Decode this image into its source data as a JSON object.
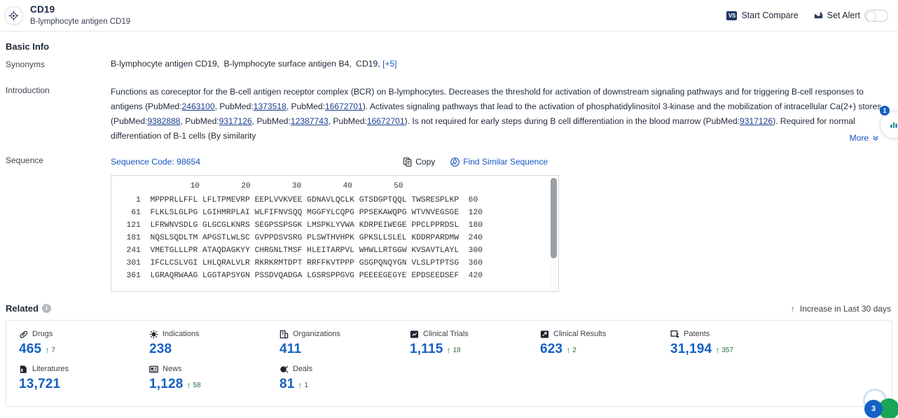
{
  "header": {
    "logo_icon": "target-crosshair-icon",
    "name": "CD19",
    "subtitle": "B-lymphocyte antigen CD19",
    "compare_label": "Start Compare",
    "compare_icon": "vs-icon",
    "alert_label": "Set Alert",
    "alert_icon": "bell-envelope-icon",
    "alert_toggle_on": false
  },
  "basic_info": {
    "title": "Basic Info",
    "synonyms_label": "Synonyms",
    "synonyms": [
      "B-lymphocyte antigen CD19",
      "B-lymphocyte surface antigen B4",
      "CD19"
    ],
    "synonyms_more": "[+5]",
    "introduction_label": "Introduction",
    "introduction": {
      "p1": "Functions as coreceptor for the B-cell antigen receptor complex (BCR) on B-lymphocytes. Decreases the threshold for activation of downstream signaling pathways and for triggering B-cell responses to antigens (PubMed:",
      "refs1": [
        "2463100",
        "1373518",
        "16672701"
      ],
      "p2": "). Activates signaling pathways that lead to the activation of phosphatidylinositol 3-kinase and the mobilization of intracellular Ca(2+) stores (PubMed:",
      "refs2": [
        "9382888",
        "9317126",
        "12387743",
        "16672701"
      ],
      "p3": "). Is not required for early steps during B cell differentiation in the blood marrow (PubMed:",
      "refs3": [
        "9317126"
      ],
      "p4": "). Required for normal differentiation of B-1 cells (By similarity",
      "more_label": "More",
      "more_icon": "chevron-double-down-icon"
    }
  },
  "sequence": {
    "label": "Sequence",
    "code_label": "Sequence Code: 98654",
    "copy_label": "Copy",
    "copy_icon": "copy-icon",
    "find_label": "Find Similar Sequence",
    "find_icon": "search-similar-icon",
    "ruler_ticks": [
      "10",
      "20",
      "30",
      "40",
      "50"
    ],
    "rows": [
      {
        "start": "1",
        "blocks": [
          "MPPPRLLFFL",
          "LFLTPMEVRP",
          "EEPLVVKVEE",
          "GDNAVLQCLK",
          "GTSDGPTQQL",
          "TWSRESPLKP"
        ],
        "end": "60"
      },
      {
        "start": "61",
        "blocks": [
          "FLKLSLGLPG",
          "LGIHMRPLAI",
          "WLFIFNVSQQ",
          "MGGFYLCQPG",
          "PPSEKAWQPG",
          "WTVNVEGSGE"
        ],
        "end": "120"
      },
      {
        "start": "121",
        "blocks": [
          "LFRWNVSDLG",
          "GLGCGLKNRS",
          "SEGPSSPSGK",
          "LMSPKLYVWA",
          "KDRPEIWEGE",
          "PPCLPPRDSL"
        ],
        "end": "180"
      },
      {
        "start": "181",
        "blocks": [
          "NQSLSQDLTM",
          "APGSTLWLSC",
          "GVPPDSVSRG",
          "PLSWTHVHPK",
          "GPKSLLSLEL",
          "KDDRPARDMW"
        ],
        "end": "240"
      },
      {
        "start": "241",
        "blocks": [
          "VMETGLLLPR",
          "ATAQDAGKYY",
          "CHRGNLTMSF",
          "HLEITARPVL",
          "WHWLLRTGGW",
          "KVSAVTLAYL"
        ],
        "end": "300"
      },
      {
        "start": "301",
        "blocks": [
          "IFCLCSLVGI",
          "LHLQRALVLR",
          "RKRKRMTDPT",
          "RRFFKVTPPP",
          "GSGPQNQYGN",
          "VLSLPTPTSG"
        ],
        "end": "360"
      },
      {
        "start": "361",
        "blocks": [
          "LGRAQRWAAG",
          "LGGTAPSYGN",
          "PSSDVQADGA",
          "LGSRSPPGVG",
          "PEEEEGEGYE",
          "EPDSEEDSEF"
        ],
        "end": "420"
      }
    ]
  },
  "related": {
    "title": "Related",
    "info_icon": "info-icon",
    "legend_icon": "arrow-up-icon",
    "legend_label": "Increase in Last 30 days",
    "stats": [
      {
        "icon": "pill-icon",
        "label": "Drugs",
        "value": "465",
        "delta": "7"
      },
      {
        "icon": "virus-icon",
        "label": "Indications",
        "value": "238",
        "delta": ""
      },
      {
        "icon": "building-icon",
        "label": "Organizations",
        "value": "411",
        "delta": ""
      },
      {
        "icon": "clinical-trial-icon",
        "label": "Clinical Trials",
        "value": "1,115",
        "delta": "18"
      },
      {
        "icon": "clinical-result-icon",
        "label": "Clinical Results",
        "value": "623",
        "delta": "2"
      },
      {
        "icon": "patent-icon",
        "label": "Patents",
        "value": "31,194",
        "delta": "357"
      },
      {
        "icon": "literature-icon",
        "label": "Literatures",
        "value": "13,721",
        "delta": ""
      },
      {
        "icon": "news-icon",
        "label": "News",
        "value": "1,128",
        "delta": "58"
      },
      {
        "icon": "deal-icon",
        "label": "Deals",
        "value": "81",
        "delta": "1"
      }
    ]
  },
  "floating": {
    "mid_badge": "1",
    "mid_icon": "chart-widget-icon",
    "bottom_badge": "3"
  },
  "colors": {
    "accent_blue": "#1560c4",
    "link_blue": "#1455c0",
    "green": "#1a8a3a",
    "navy": "#1f3864"
  }
}
